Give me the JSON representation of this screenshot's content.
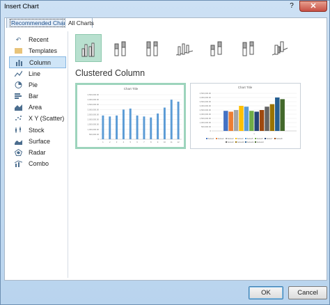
{
  "window": {
    "title": "Insert Chart",
    "help": "?",
    "close": "✕"
  },
  "tabs": [
    {
      "label": "Recommended Charts"
    },
    {
      "label": "All Charts"
    }
  ],
  "sidebar": {
    "items": [
      {
        "label": "Recent",
        "icon": "recent-icon"
      },
      {
        "label": "Templates",
        "icon": "templates-icon"
      },
      {
        "label": "Column",
        "icon": "column-icon"
      },
      {
        "label": "Line",
        "icon": "line-icon"
      },
      {
        "label": "Pie",
        "icon": "pie-icon"
      },
      {
        "label": "Bar",
        "icon": "bar-icon"
      },
      {
        "label": "Area",
        "icon": "area-icon"
      },
      {
        "label": "X Y (Scatter)",
        "icon": "scatter-icon"
      },
      {
        "label": "Stock",
        "icon": "stock-icon"
      },
      {
        "label": "Surface",
        "icon": "surface-icon"
      },
      {
        "label": "Radar",
        "icon": "radar-icon"
      },
      {
        "label": "Combo",
        "icon": "combo-icon"
      }
    ],
    "selected": "Column"
  },
  "subtypes": {
    "count": 7,
    "selected_index": 0
  },
  "heading": "Clustered Column",
  "colors": {
    "accent": "#cfe5f7",
    "selected_green": "#9dd4bc",
    "bar_blue": "#5b9bd5"
  },
  "chart_data": [
    {
      "type": "bar",
      "title": "Chart Title",
      "categories": [
        "1",
        "2",
        "3",
        "4",
        "5",
        "6",
        "7",
        "8",
        "9",
        "10",
        "11",
        "12"
      ],
      "values": [
        2400000,
        2300000,
        2400000,
        3000000,
        3100000,
        2400000,
        2300000,
        2200000,
        2600000,
        3200000,
        4000000,
        3800000
      ],
      "ylim": [
        0,
        4500000
      ],
      "yticks": [
        "0",
        "500,000.00",
        "1,000,000.00",
        "1,500,000.00",
        "2,000,000.00",
        "2,500,000.00",
        "3,000,000.00",
        "3,500,000.00",
        "4,000,000.00",
        "4,500,000.00"
      ],
      "grid": true
    },
    {
      "type": "bar",
      "title": "Chart Title",
      "categories": [
        "1"
      ],
      "series": [
        {
          "name": "Series1",
          "values": [
            2400000
          ],
          "color": "#4472c4"
        },
        {
          "name": "Series2",
          "values": [
            2300000
          ],
          "color": "#ed7d31"
        },
        {
          "name": "Series3",
          "values": [
            2500000
          ],
          "color": "#a5a5a5"
        },
        {
          "name": "Series4",
          "values": [
            3000000
          ],
          "color": "#ffc000"
        },
        {
          "name": "Series5",
          "values": [
            2900000
          ],
          "color": "#5b9bd5"
        },
        {
          "name": "Series6",
          "values": [
            2400000
          ],
          "color": "#70ad47"
        },
        {
          "name": "Series7",
          "values": [
            2300000
          ],
          "color": "#264478"
        },
        {
          "name": "Series8",
          "values": [
            2500000
          ],
          "color": "#9e480e"
        },
        {
          "name": "Series9",
          "values": [
            2900000
          ],
          "color": "#636363"
        },
        {
          "name": "Series10",
          "values": [
            3200000
          ],
          "color": "#997300"
        },
        {
          "name": "Series11",
          "values": [
            4000000
          ],
          "color": "#255e91"
        },
        {
          "name": "Series12",
          "values": [
            3800000
          ],
          "color": "#43682b"
        }
      ],
      "ylim": [
        0,
        4500000
      ],
      "yticks": [
        "0",
        "500,000.00",
        "1,000,000.00",
        "1,500,000.00",
        "2,000,000.00",
        "2,500,000.00",
        "3,000,000.00",
        "3,500,000.00",
        "4,000,000.00",
        "4,500,000.00"
      ],
      "grid": true,
      "legend": "bottom"
    }
  ],
  "footer": {
    "ok_label": "OK",
    "cancel_label": "Cancel"
  }
}
